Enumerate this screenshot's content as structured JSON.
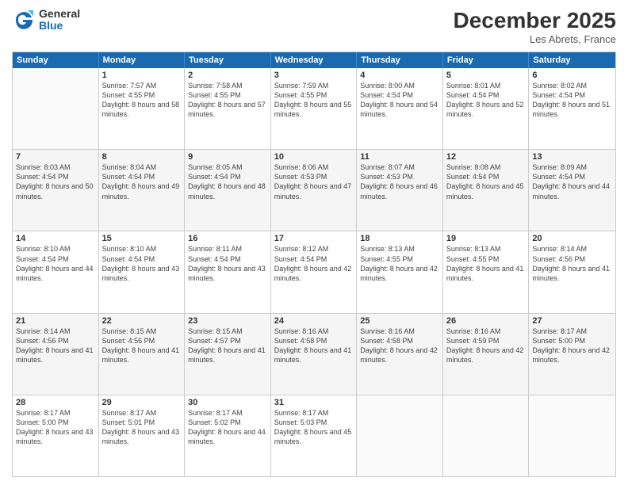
{
  "logo": {
    "general": "General",
    "blue": "Blue"
  },
  "title": "December 2025",
  "location": "Les Abrets, France",
  "weekdays": [
    "Sunday",
    "Monday",
    "Tuesday",
    "Wednesday",
    "Thursday",
    "Friday",
    "Saturday"
  ],
  "rows": [
    [
      {
        "day": "",
        "sunrise": "",
        "sunset": "",
        "daylight": ""
      },
      {
        "day": "1",
        "sunrise": "Sunrise: 7:57 AM",
        "sunset": "Sunset: 4:55 PM",
        "daylight": "Daylight: 8 hours and 58 minutes."
      },
      {
        "day": "2",
        "sunrise": "Sunrise: 7:58 AM",
        "sunset": "Sunset: 4:55 PM",
        "daylight": "Daylight: 8 hours and 57 minutes."
      },
      {
        "day": "3",
        "sunrise": "Sunrise: 7:59 AM",
        "sunset": "Sunset: 4:55 PM",
        "daylight": "Daylight: 8 hours and 55 minutes."
      },
      {
        "day": "4",
        "sunrise": "Sunrise: 8:00 AM",
        "sunset": "Sunset: 4:54 PM",
        "daylight": "Daylight: 8 hours and 54 minutes."
      },
      {
        "day": "5",
        "sunrise": "Sunrise: 8:01 AM",
        "sunset": "Sunset: 4:54 PM",
        "daylight": "Daylight: 8 hours and 52 minutes."
      },
      {
        "day": "6",
        "sunrise": "Sunrise: 8:02 AM",
        "sunset": "Sunset: 4:54 PM",
        "daylight": "Daylight: 8 hours and 51 minutes."
      }
    ],
    [
      {
        "day": "7",
        "sunrise": "Sunrise: 8:03 AM",
        "sunset": "Sunset: 4:54 PM",
        "daylight": "Daylight: 8 hours and 50 minutes."
      },
      {
        "day": "8",
        "sunrise": "Sunrise: 8:04 AM",
        "sunset": "Sunset: 4:54 PM",
        "daylight": "Daylight: 8 hours and 49 minutes."
      },
      {
        "day": "9",
        "sunrise": "Sunrise: 8:05 AM",
        "sunset": "Sunset: 4:54 PM",
        "daylight": "Daylight: 8 hours and 48 minutes."
      },
      {
        "day": "10",
        "sunrise": "Sunrise: 8:06 AM",
        "sunset": "Sunset: 4:53 PM",
        "daylight": "Daylight: 8 hours and 47 minutes."
      },
      {
        "day": "11",
        "sunrise": "Sunrise: 8:07 AM",
        "sunset": "Sunset: 4:53 PM",
        "daylight": "Daylight: 8 hours and 46 minutes."
      },
      {
        "day": "12",
        "sunrise": "Sunrise: 8:08 AM",
        "sunset": "Sunset: 4:54 PM",
        "daylight": "Daylight: 8 hours and 45 minutes."
      },
      {
        "day": "13",
        "sunrise": "Sunrise: 8:09 AM",
        "sunset": "Sunset: 4:54 PM",
        "daylight": "Daylight: 8 hours and 44 minutes."
      }
    ],
    [
      {
        "day": "14",
        "sunrise": "Sunrise: 8:10 AM",
        "sunset": "Sunset: 4:54 PM",
        "daylight": "Daylight: 8 hours and 44 minutes."
      },
      {
        "day": "15",
        "sunrise": "Sunrise: 8:10 AM",
        "sunset": "Sunset: 4:54 PM",
        "daylight": "Daylight: 8 hours and 43 minutes."
      },
      {
        "day": "16",
        "sunrise": "Sunrise: 8:11 AM",
        "sunset": "Sunset: 4:54 PM",
        "daylight": "Daylight: 8 hours and 43 minutes."
      },
      {
        "day": "17",
        "sunrise": "Sunrise: 8:12 AM",
        "sunset": "Sunset: 4:54 PM",
        "daylight": "Daylight: 8 hours and 42 minutes."
      },
      {
        "day": "18",
        "sunrise": "Sunrise: 8:13 AM",
        "sunset": "Sunset: 4:55 PM",
        "daylight": "Daylight: 8 hours and 42 minutes."
      },
      {
        "day": "19",
        "sunrise": "Sunrise: 8:13 AM",
        "sunset": "Sunset: 4:55 PM",
        "daylight": "Daylight: 8 hours and 41 minutes."
      },
      {
        "day": "20",
        "sunrise": "Sunrise: 8:14 AM",
        "sunset": "Sunset: 4:56 PM",
        "daylight": "Daylight: 8 hours and 41 minutes."
      }
    ],
    [
      {
        "day": "21",
        "sunrise": "Sunrise: 8:14 AM",
        "sunset": "Sunset: 4:56 PM",
        "daylight": "Daylight: 8 hours and 41 minutes."
      },
      {
        "day": "22",
        "sunrise": "Sunrise: 8:15 AM",
        "sunset": "Sunset: 4:56 PM",
        "daylight": "Daylight: 8 hours and 41 minutes."
      },
      {
        "day": "23",
        "sunrise": "Sunrise: 8:15 AM",
        "sunset": "Sunset: 4:57 PM",
        "daylight": "Daylight: 8 hours and 41 minutes."
      },
      {
        "day": "24",
        "sunrise": "Sunrise: 8:16 AM",
        "sunset": "Sunset: 4:58 PM",
        "daylight": "Daylight: 8 hours and 41 minutes."
      },
      {
        "day": "25",
        "sunrise": "Sunrise: 8:16 AM",
        "sunset": "Sunset: 4:58 PM",
        "daylight": "Daylight: 8 hours and 42 minutes."
      },
      {
        "day": "26",
        "sunrise": "Sunrise: 8:16 AM",
        "sunset": "Sunset: 4:59 PM",
        "daylight": "Daylight: 8 hours and 42 minutes."
      },
      {
        "day": "27",
        "sunrise": "Sunrise: 8:17 AM",
        "sunset": "Sunset: 5:00 PM",
        "daylight": "Daylight: 8 hours and 42 minutes."
      }
    ],
    [
      {
        "day": "28",
        "sunrise": "Sunrise: 8:17 AM",
        "sunset": "Sunset: 5:00 PM",
        "daylight": "Daylight: 8 hours and 43 minutes."
      },
      {
        "day": "29",
        "sunrise": "Sunrise: 8:17 AM",
        "sunset": "Sunset: 5:01 PM",
        "daylight": "Daylight: 8 hours and 43 minutes."
      },
      {
        "day": "30",
        "sunrise": "Sunrise: 8:17 AM",
        "sunset": "Sunset: 5:02 PM",
        "daylight": "Daylight: 8 hours and 44 minutes."
      },
      {
        "day": "31",
        "sunrise": "Sunrise: 8:17 AM",
        "sunset": "Sunset: 5:03 PM",
        "daylight": "Daylight: 8 hours and 45 minutes."
      },
      {
        "day": "",
        "sunrise": "",
        "sunset": "",
        "daylight": ""
      },
      {
        "day": "",
        "sunrise": "",
        "sunset": "",
        "daylight": ""
      },
      {
        "day": "",
        "sunrise": "",
        "sunset": "",
        "daylight": ""
      }
    ]
  ]
}
